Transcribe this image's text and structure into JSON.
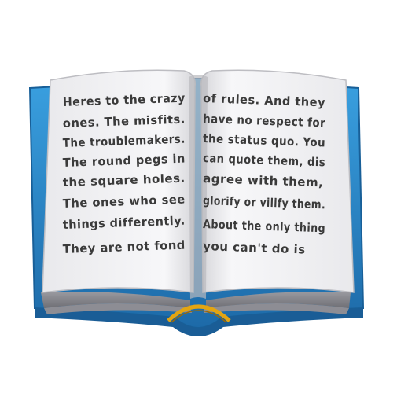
{
  "book": {
    "left_page": {
      "lines": [
        "Heres to the crazy",
        "ones. The misfits.",
        "The troublemakers.",
        "The round pegs in",
        "the square holes.",
        "The ones who see",
        "things differently.",
        "They are not fond"
      ]
    },
    "right_page": {
      "lines": [
        "of rules. And they",
        "have no respect for",
        "the status quo. You",
        "can quote them, dis",
        "agree with them,",
        "glorify or vilify them.",
        "About the only thing",
        "you can't do is"
      ]
    },
    "colors": {
      "cover": "#2f8fd0",
      "cover_dark": "#1f6fae",
      "page": "#f4f4f6",
      "page_shadow": "#c8c8cc",
      "spine_accent": "#e3a512"
    }
  }
}
